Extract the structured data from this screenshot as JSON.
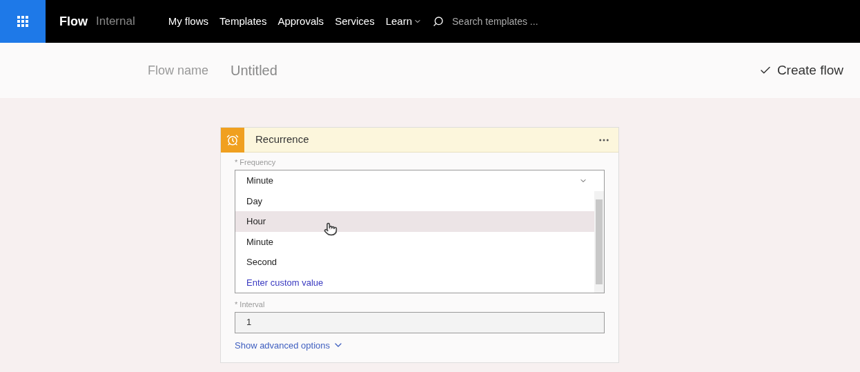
{
  "app_bar": {
    "brand": "Flow",
    "environment": "Internal",
    "nav": [
      {
        "label": "My flows",
        "has_caret": false
      },
      {
        "label": "Templates",
        "has_caret": false
      },
      {
        "label": "Approvals",
        "has_caret": false
      },
      {
        "label": "Services",
        "has_caret": false
      },
      {
        "label": "Learn",
        "has_caret": true
      }
    ],
    "search": {
      "placeholder": "Search templates ..."
    }
  },
  "header": {
    "name_label": "Flow name",
    "name_value": "Untitled",
    "create_label": "Create flow"
  },
  "card": {
    "title": "Recurrence",
    "frequency": {
      "label": "* Frequency",
      "value": "Minute",
      "options": [
        {
          "label": "Day",
          "kind": "option",
          "highlighted": false
        },
        {
          "label": "Hour",
          "kind": "option",
          "highlighted": true
        },
        {
          "label": "Minute",
          "kind": "option",
          "highlighted": false
        },
        {
          "label": "Second",
          "kind": "option",
          "highlighted": false
        },
        {
          "label": "Enter custom value",
          "kind": "custom",
          "highlighted": false
        }
      ]
    },
    "interval": {
      "label": "* Interval",
      "value": "1"
    },
    "advanced_link": "Show advanced options"
  }
}
